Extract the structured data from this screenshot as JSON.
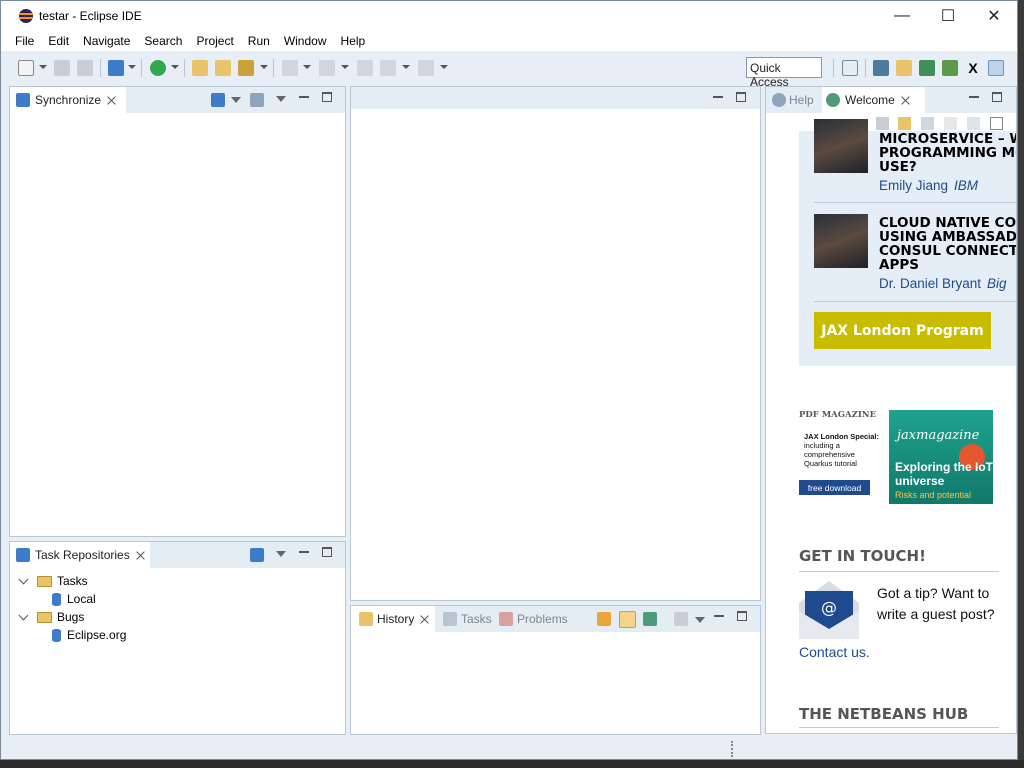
{
  "window": {
    "title": "testar - Eclipse IDE"
  },
  "menu": [
    "File",
    "Edit",
    "Navigate",
    "Search",
    "Project",
    "Run",
    "Window",
    "Help"
  ],
  "toolbar": {
    "quick_access": "Quick Access"
  },
  "synchronize": {
    "tab": "Synchronize"
  },
  "task_repositories": {
    "tab": "Task Repositories",
    "tree": [
      {
        "label": "Tasks",
        "children": [
          "Local"
        ]
      },
      {
        "label": "Bugs",
        "children": [
          "Eclipse.org"
        ]
      }
    ]
  },
  "bottom_tabs": {
    "history": "History",
    "tasks": "Tasks",
    "problems": "Problems"
  },
  "welcome": {
    "tab_help": "Help",
    "tab_welcome": "Welcome",
    "speakers": [
      {
        "title_lines": [
          "MICROSERVICE – W",
          "PROGRAMMING MO",
          "USE?"
        ],
        "name": "Emily Jiang",
        "org": "IBM"
      },
      {
        "title_lines": [
          "CLOUD NATIVE CO",
          "USING AMBASSAD",
          "CONSUL CONNECT",
          "APPS"
        ],
        "name": "Dr. Daniel Bryant",
        "org": "Big"
      }
    ],
    "program_button": "JAX London Program",
    "pdf_magazine": "PDF MAGAZINE",
    "mag_title": "JAX London Special:",
    "mag_desc": "including a comprehensive Quarkus tutorial",
    "free_download": "free download",
    "cover_logo": "jaxmagazine",
    "cover_title": "Exploring the IoT universe",
    "cover_sub": "Risks and potential",
    "get_in_touch": "GET IN TOUCH!",
    "tip_text": "Got a tip? Want to write a guest post?",
    "contact": "Contact us.",
    "netbeans": "THE NETBEANS HUB"
  }
}
